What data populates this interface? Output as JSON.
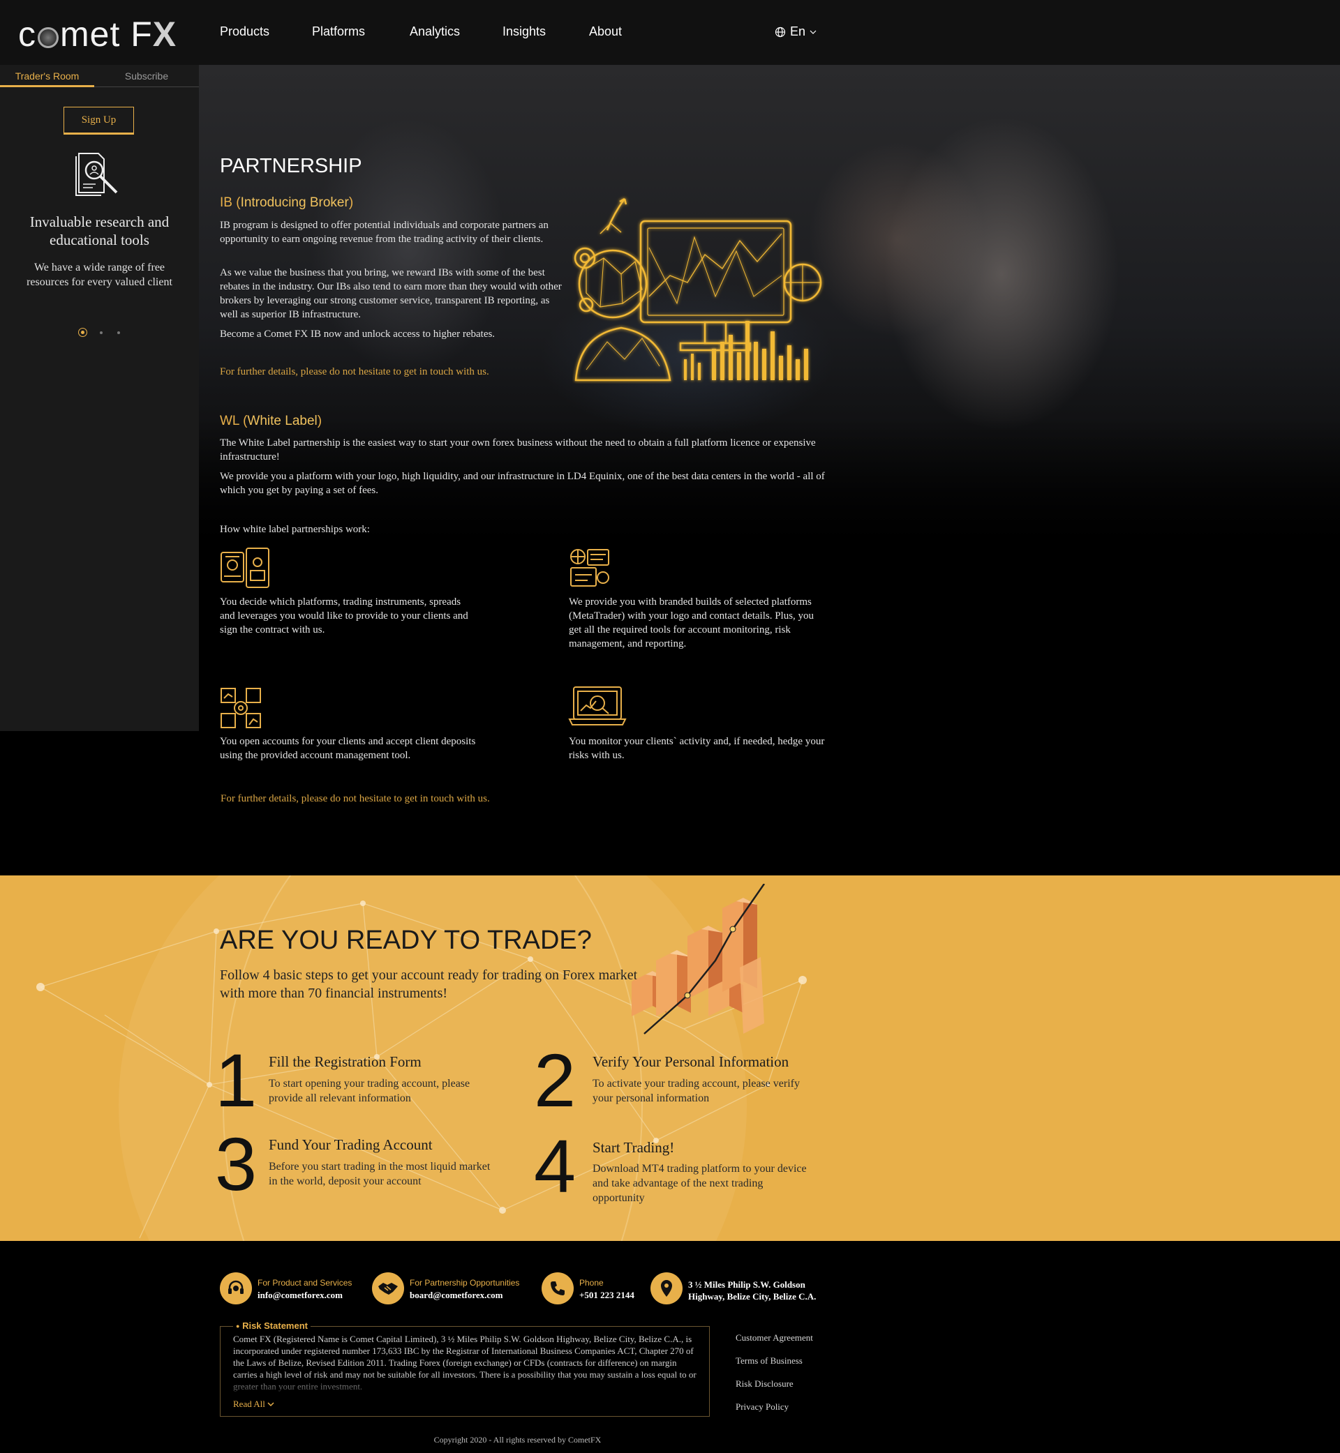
{
  "header": {
    "logo_text_1": "c",
    "logo_text_2": "met F",
    "logo_text_3": "X",
    "nav": [
      "Products",
      "Platforms",
      "Analytics",
      "Insights",
      "About"
    ],
    "language": "En"
  },
  "sidebar": {
    "tabs": [
      "Trader's Room",
      "Subscribe"
    ],
    "signup_label": "Sign Up",
    "title": "Invaluable research and educational tools",
    "text": "We have a wide range of free resources for every valued client"
  },
  "partnership": {
    "title": "PARTNERSHIP",
    "ib": {
      "abbr": "IB",
      "name": "Introducing Broker",
      "p1": "IB program is designed to offer potential individuals and corporate partners an opportunity to earn ongoing revenue from the trading activity of their clients.",
      "p2": "As we value the business that you bring, we reward IBs with some of the best rebates in the industry. Our IBs also tend to earn more than they would with other brokers by leveraging our strong customer service, transparent IB reporting, as well as superior IB infrastructure.",
      "p3": "Become a Comet FX IB now and unlock access to higher rebates.",
      "contact": "For further details, please do not hesitate to get in touch with us."
    },
    "wl": {
      "abbr": "WL",
      "name": "White Label",
      "p1": "The White Label partnership is the easiest way to start your own forex business without the need to obtain a full platform licence or expensive infrastructure!",
      "p2": "We provide you a platform with your logo, high liquidity, and our infrastructure in LD4 Equinix, one of the best data centers in the world - all of which you get by paying a set of fees.",
      "how_title": "How white label partnerships work:",
      "steps": [
        "You decide which platforms, trading instruments, spreads and leverages you would like to provide to your clients and sign the contract with us.",
        "We provide you with branded builds of selected platforms (MetaTrader) with your logo and contact details. Plus, you get all the required tools for account monitoring, risk management, and reporting.",
        "You open accounts for your clients and accept client deposits using the provided account management tool.",
        "You monitor your clients` activity and, if needed, hedge your risks with us."
      ],
      "contact": "For further details, please do not hesitate to get in touch with us."
    }
  },
  "ready": {
    "title": "ARE YOU READY TO TRADE?",
    "subtitle": "Follow 4 basic steps to get your account ready for trading on Forex market with more than 70 financial instruments!",
    "steps": [
      {
        "num": "1",
        "title": "Fill the Registration Form",
        "text": "To start opening your trading account, please provide all relevant information"
      },
      {
        "num": "2",
        "title": "Verify Your Personal Information",
        "text": "To activate your trading account, please verify your personal information"
      },
      {
        "num": "3",
        "title": "Fund Your Trading Account",
        "text": "Before you start trading in the most liquid market in the world, deposit your account"
      },
      {
        "num": "4",
        "title": "Start Trading!",
        "text": "Download MT4 trading platform to your device and take advantage of the next trading opportunity"
      }
    ]
  },
  "footer": {
    "contacts": [
      {
        "label": "For Product and Services",
        "value": "info@cometforex.com",
        "icon": "headset-icon"
      },
      {
        "label": "For Partnership Opportunities",
        "value": "board@cometforex.com",
        "icon": "handshake-icon"
      },
      {
        "label": "Phone",
        "value": "+501 223 2144",
        "icon": "phone-icon"
      },
      {
        "label": "",
        "value_1": "3 ½ Miles Philip S.W. Goldson",
        "value_2": "Highway, Belize City, Belize C.A.",
        "icon": "location-pin-icon"
      }
    ],
    "risk_title": "Risk Statement",
    "risk_text": "Comet FX (Registered Name is Comet Capital Limited), 3 ½ Miles Philip S.W. Goldson Highway, Belize City, Belize C.A., is incorporated under registered number 173,633 IBC by the Registrar of International Business Companies ACT, Chapter 270 of the Laws of Belize, Revised Edition 2011. Trading Forex (foreign exchange) or CFDs (contracts for difference) on margin carries a high level of risk and may not be suitable for all investors. There is a possibility that you may sustain a loss equal to or greater than your entire investment.",
    "read_all": "Read All",
    "links": [
      "Customer Agreement",
      "Terms of Business",
      "Risk Disclosure",
      "Privacy Policy"
    ],
    "copyright": "Copyright 2020 - All rights reserved by CometFX"
  },
  "colors": {
    "accent": "#e8b04a",
    "background": "#000000",
    "panel": "#1a1a1a"
  }
}
